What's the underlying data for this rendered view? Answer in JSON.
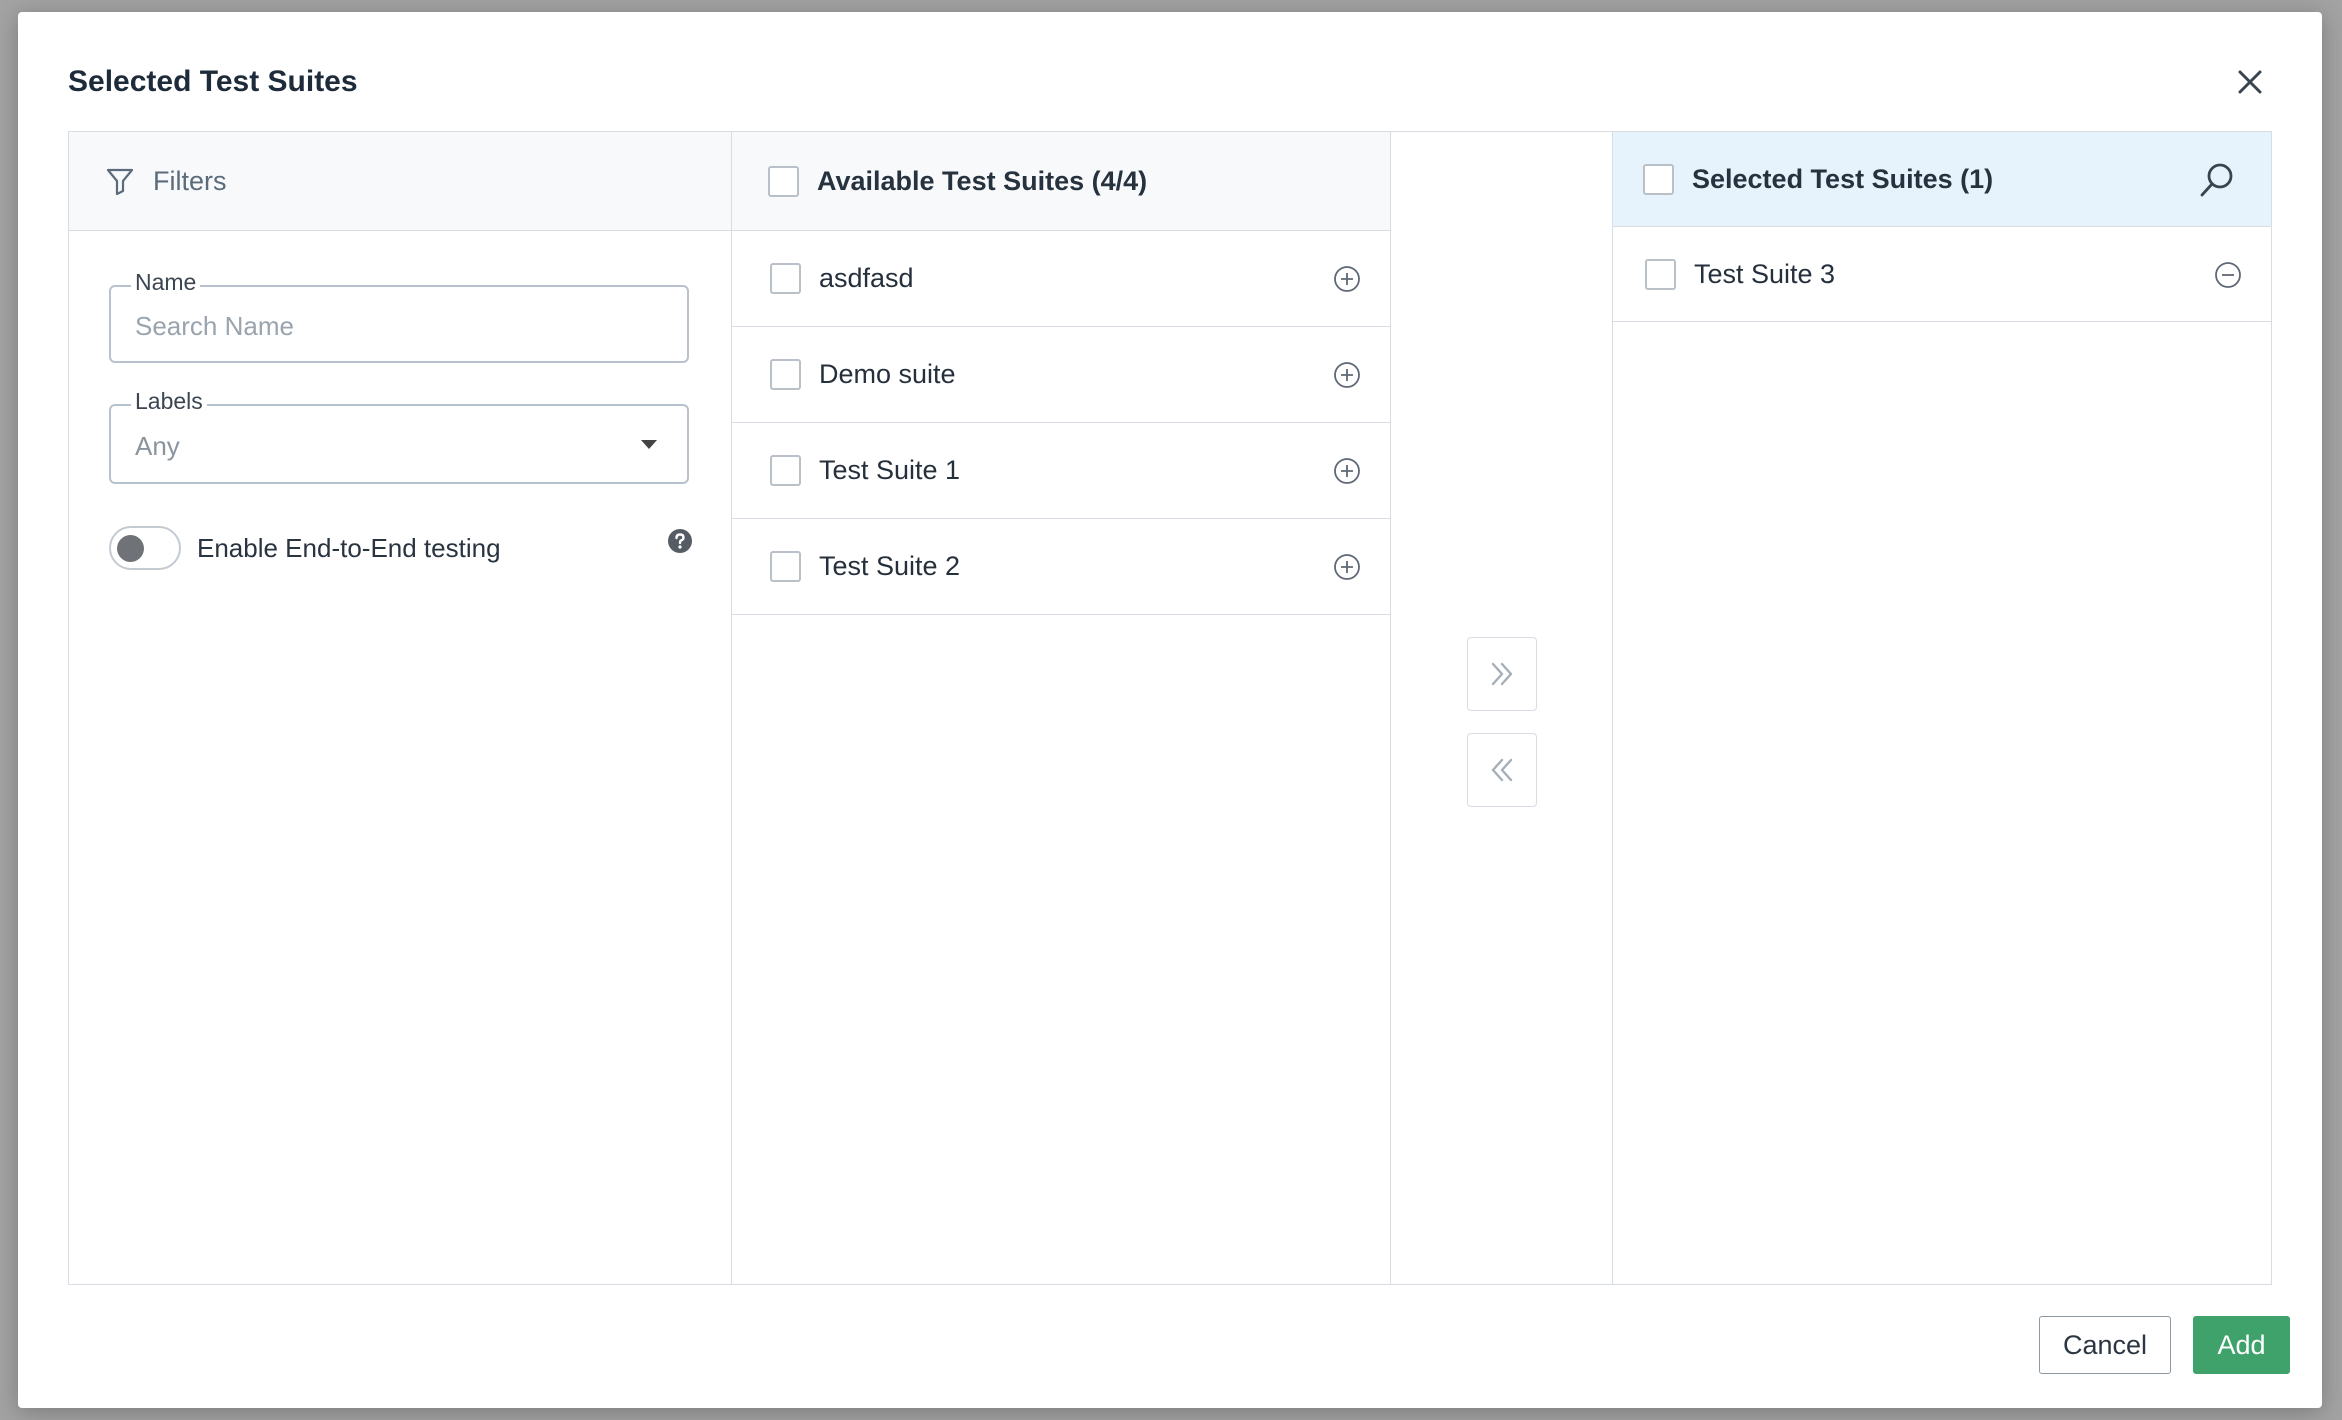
{
  "modal": {
    "title": "Selected Test Suites"
  },
  "filters": {
    "header": "Filters",
    "name_field": {
      "label": "Name",
      "placeholder": "Search Name",
      "value": ""
    },
    "labels_field": {
      "label": "Labels",
      "selected": "Any"
    },
    "e2e_toggle": {
      "label": "Enable End-to-End testing",
      "enabled": false
    }
  },
  "available": {
    "header": "Available Test Suites (4/4)",
    "items": [
      {
        "label": "asdfasd"
      },
      {
        "label": "Demo suite"
      },
      {
        "label": "Test Suite 1"
      },
      {
        "label": "Test Suite 2"
      }
    ]
  },
  "selected": {
    "header": "Selected Test Suites (1)",
    "items": [
      {
        "label": "Test Suite 3"
      }
    ]
  },
  "footer": {
    "cancel_label": "Cancel",
    "add_label": "Add"
  },
  "colors": {
    "primary": "#3fa26b",
    "selected_header_bg": "#e7f3fc",
    "border": "#d8dde3"
  }
}
